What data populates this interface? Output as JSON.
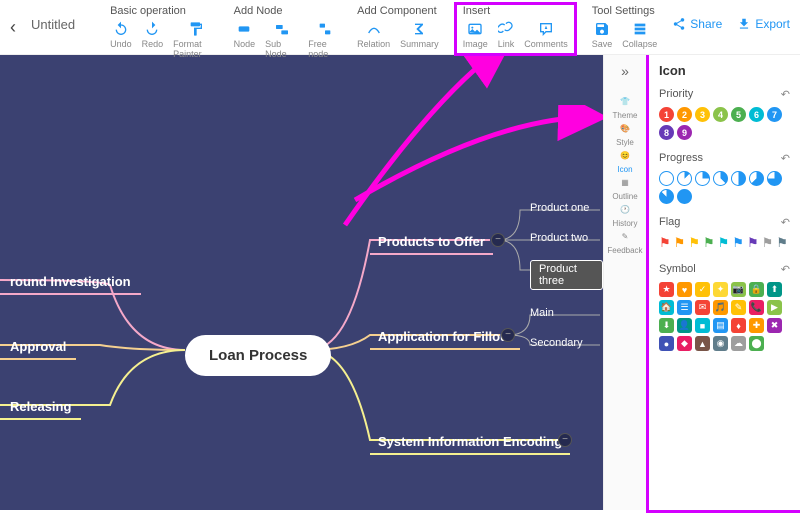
{
  "title": "Untitled",
  "toolbar": {
    "basic": {
      "label": "Basic operation",
      "items": [
        {
          "l": "Undo",
          "i": "undo"
        },
        {
          "l": "Redo",
          "i": "redo"
        },
        {
          "l": "Format Painter",
          "i": "paint"
        }
      ]
    },
    "addnode": {
      "label": "Add Node",
      "items": [
        {
          "l": "Node",
          "i": "node"
        },
        {
          "l": "Sub Node",
          "i": "subnode"
        },
        {
          "l": "Free node",
          "i": "freenode"
        }
      ]
    },
    "addcomp": {
      "label": "Add Component",
      "items": [
        {
          "l": "Relation",
          "i": "rel"
        },
        {
          "l": "Summary",
          "i": "sum"
        }
      ]
    },
    "insert": {
      "label": "Insert",
      "items": [
        {
          "l": "Image",
          "i": "img"
        },
        {
          "l": "Link",
          "i": "link"
        },
        {
          "l": "Comments",
          "i": "comment"
        }
      ]
    },
    "toolset": {
      "label": "Tool Settings",
      "items": [
        {
          "l": "Save",
          "i": "save"
        },
        {
          "l": "Collapse",
          "i": "collapse"
        }
      ]
    }
  },
  "actions": {
    "share": "Share",
    "export": "Export"
  },
  "mindmap": {
    "center": "Loan Process",
    "left": [
      {
        "l": "round Investigation",
        "c": "#f5a9c9"
      },
      {
        "l": "Approval",
        "c": "#f5d090"
      },
      {
        "l": "Releasing",
        "c": "#f5f090"
      }
    ],
    "right": [
      {
        "l": "Products to Offer",
        "c": "#f5a9c9",
        "ch": [
          "Product one",
          "Product two",
          "Product three"
        ]
      },
      {
        "l": "Application for Fillout",
        "c": "#f5d090",
        "ch": [
          "Main",
          "Secondary"
        ]
      },
      {
        "l": "System Information Encoding",
        "c": "#f5f090",
        "ch": []
      }
    ]
  },
  "panel": {
    "title": "Icon",
    "tabs": [
      {
        "l": "Theme",
        "i": "👕"
      },
      {
        "l": "Style",
        "i": "🎨"
      },
      {
        "l": "Icon",
        "i": "😊",
        "a": true
      },
      {
        "l": "Outline",
        "i": "▦"
      },
      {
        "l": "History",
        "i": "🕐"
      },
      {
        "l": "Feedback",
        "i": "✎"
      }
    ],
    "sections": {
      "priority": {
        "label": "Priority",
        "items": [
          "#f44336",
          "#ff9800",
          "#ffc107",
          "#8bc34a",
          "#4caf50",
          "#00bcd4",
          "#2196f3",
          "#673ab7",
          "#9c27b0"
        ]
      },
      "progress": {
        "label": "Progress",
        "items": [
          0,
          0.125,
          0.25,
          0.375,
          0.5,
          0.625,
          0.75,
          0.875,
          1
        ]
      },
      "flag": {
        "label": "Flag",
        "items": [
          "#f44336",
          "#ff9800",
          "#ffc107",
          "#4caf50",
          "#00bcd4",
          "#2196f3",
          "#673ab7",
          "#9e9e9e",
          "#607d8b"
        ]
      },
      "symbol": {
        "label": "Symbol",
        "items": [
          "#f44336",
          "#ff9800",
          "#ffc107",
          "#fdd835",
          "#8bc34a",
          "#4caf50",
          "#009688",
          "#00bcd4",
          "#2196f3",
          "#f44336",
          "#ff9800",
          "#ffc107",
          "#e91e63",
          "#8bc34a",
          "#4caf50",
          "#009688",
          "#00bcd4",
          "#2196f3",
          "#f44336",
          "#ff9800",
          "#9c27b0",
          "#3f51b5",
          "#e91e63",
          "#795548",
          "#607d8b",
          "#9e9e9e",
          "#4caf50"
        ]
      }
    }
  }
}
